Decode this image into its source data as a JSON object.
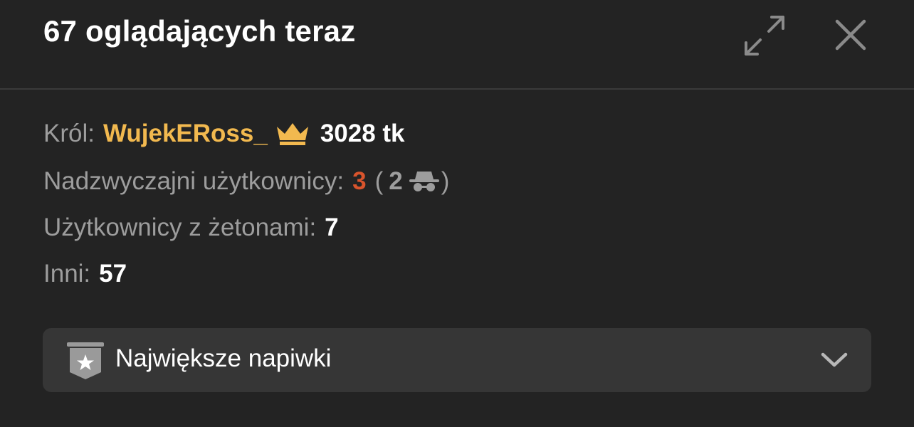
{
  "header": {
    "title": "67 oglądających teraz",
    "expand_icon": "expand-arrows-icon",
    "close_icon": "close-x-icon"
  },
  "stats": {
    "king_label": "Król:",
    "king_name": "WujekERoss_",
    "king_icon": "crown-icon",
    "king_tokens": "3028 tk",
    "super_label": "Nadzwyczajni użytkownicy:",
    "super_count": "3",
    "super_open_paren": "(",
    "super_anon_count": "2",
    "super_anon_icon": "incognito-spy-icon",
    "super_close_paren": ")",
    "tokens_label": "Użytkownicy z żetonami:",
    "tokens_count": "7",
    "others_label": "Inni:",
    "others_count": "57"
  },
  "dropdown": {
    "label": "Największe napiwki",
    "badge_icon": "star-badge-icon",
    "chevron_icon": "chevron-down-icon"
  },
  "colors": {
    "background": "#232323",
    "label_gray": "#9d9d9d",
    "king_gold": "#f2b94f",
    "super_orange": "#d9542c",
    "dropdown_bg": "#363636"
  }
}
